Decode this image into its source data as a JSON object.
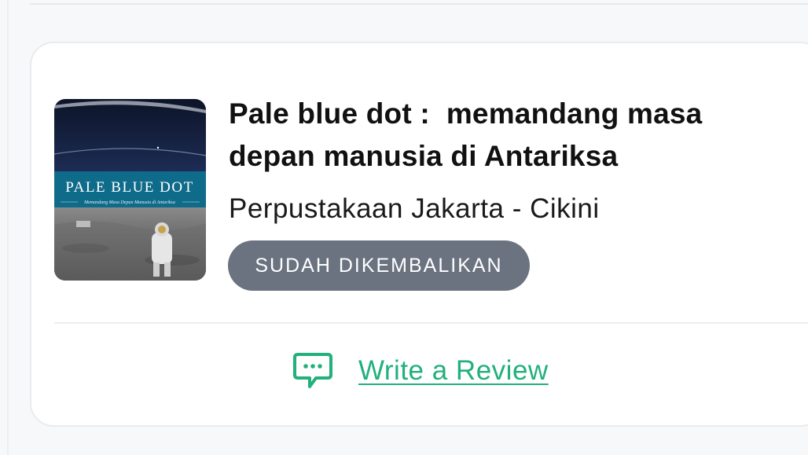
{
  "book": {
    "title": "Pale blue dot :  memandang masa depan manusia di Antariksa",
    "library": "Perpustakaan Jakarta - Cikini",
    "status": "SUDAH DIKEMBALIKAN",
    "cover": {
      "title": "PALE BLUE DOT",
      "subtitle": "Memandang Masa Depan Manusia di Antariksa"
    }
  },
  "actions": {
    "review_label": "Write a Review",
    "review_icon": "chat-bubble-icon"
  },
  "colors": {
    "accent": "#22b07d",
    "badge_bg": "#6b7280",
    "badge_text": "#ffffff",
    "title_text": "#111111"
  }
}
